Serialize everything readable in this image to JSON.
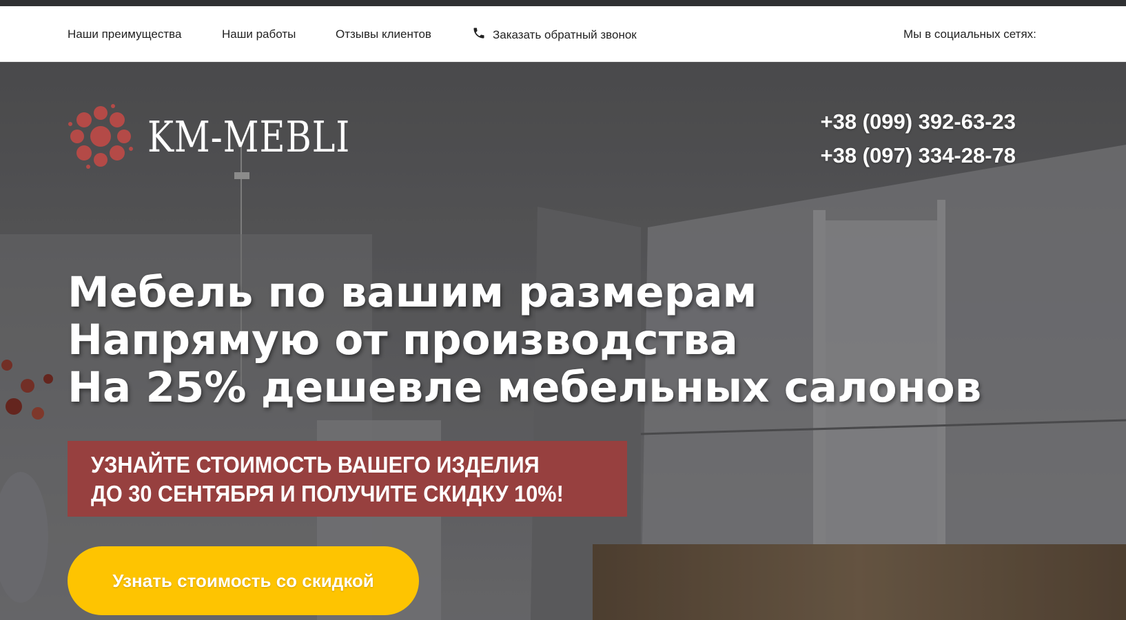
{
  "nav": {
    "advantages": "Наши преимущества",
    "works": "Наши работы",
    "reviews": "Отзывы клиентов",
    "callback": "Заказать обратный звонок",
    "callback_icon": "phone-icon",
    "social_label": "Мы в социальных сетях:"
  },
  "brand": {
    "logo_text": "KM-MEBLI",
    "logo_color": "#b44a47"
  },
  "contacts": {
    "phones": [
      "+38 (099) 392-63-23",
      "+38 (097) 334-28-78"
    ]
  },
  "hero": {
    "headline": [
      "Мебель по вашим размерам",
      "Напрямую от производства",
      "На 25% дешевле мебельных салонов"
    ],
    "promo": [
      "УЗНАЙТЕ СТОИМОСТЬ ВАШЕГО ИЗДЕЛИЯ",
      "ДО 30 СЕНТЯБРЯ И ПОЛУЧИТЕ СКИДКУ 10%!"
    ],
    "cta_label": "Узнать стоимость со скидкой"
  },
  "colors": {
    "promo_bg": "#97403f",
    "cta_bg": "#fec401",
    "navbar_bg": "#ffffff"
  }
}
